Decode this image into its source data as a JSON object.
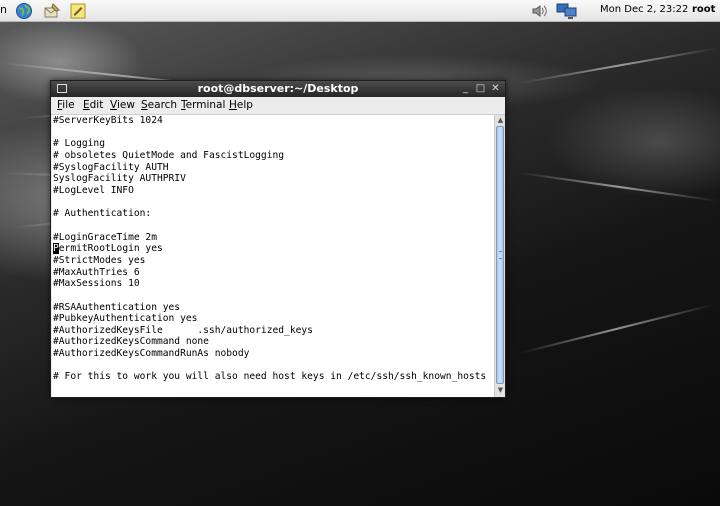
{
  "top_panel": {
    "edge_text": "n",
    "clock": "Mon Dec  2, 23:22",
    "user": "root"
  },
  "window": {
    "title": "root@dbserver:~/Desktop",
    "minimize_glyph": "_",
    "maximize_glyph": "□",
    "close_glyph": "✕"
  },
  "menubar": {
    "items": [
      {
        "label": "File",
        "u": "F",
        "rest": "ile"
      },
      {
        "label": "Edit",
        "u": "E",
        "rest": "dit"
      },
      {
        "label": "View",
        "u": "V",
        "rest": "iew"
      },
      {
        "label": "Search",
        "u": "S",
        "rest": "earch"
      },
      {
        "label": "Terminal",
        "u": "T",
        "rest": "erminal"
      },
      {
        "label": "Help",
        "u": "H",
        "rest": "elp"
      }
    ]
  },
  "terminal": {
    "lines_before_cursor": "#ServerKeyBits 1024\n\n# Logging\n# obsoletes QuietMode and FascistLogging\n#SyslogFacility AUTH\nSyslogFacility AUTHPRIV\n#LogLevel INFO\n\n# Authentication:\n\n#LoginGraceTime 2m\n",
    "cursor_char": "P",
    "lines_after_cursor": "ermitRootLogin yes\n#StrictModes yes\n#MaxAuthTries 6\n#MaxSessions 10\n\n#RSAAuthentication yes\n#PubkeyAuthentication yes\n#AuthorizedKeysFile      .ssh/authorized_keys\n#AuthorizedKeysCommand none\n#AuthorizedKeysCommandRunAs nobody\n\n# For this to work you will also need host keys in /etc/ssh/ssh_known_hosts"
  },
  "scrollbar": {
    "up_glyph": "▲",
    "down_glyph": "▼"
  },
  "icons": {
    "browser": "globe-browser-icon",
    "mail": "mail-client-icon",
    "notes": "note-editor-icon",
    "volume": "speaker-volume-icon",
    "network": "network-monitor-icon"
  }
}
